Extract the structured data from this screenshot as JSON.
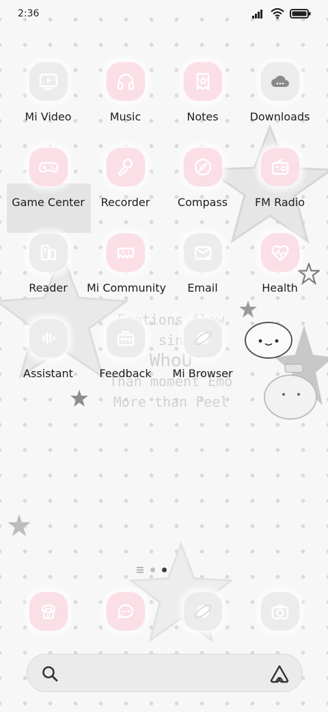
{
  "status": {
    "time": "2:36"
  },
  "wallpaper": {
    "lines": [
      "Emotions flow",
      "sin",
      "WhoU",
      "Than moment Emo",
      "More than Feel"
    ]
  },
  "apps": [
    {
      "label": "Mi Video",
      "icon": "tv-icon"
    },
    {
      "label": "Music",
      "icon": "headphones-icon"
    },
    {
      "label": "Notes",
      "icon": "notes-icon"
    },
    {
      "label": "Downloads",
      "icon": "cloud-download-icon"
    },
    {
      "label": "Game Center",
      "icon": "gamepad-icon"
    },
    {
      "label": "Recorder",
      "icon": "microphone-icon"
    },
    {
      "label": "Compass",
      "icon": "compass-icon"
    },
    {
      "label": "FM Radio",
      "icon": "radio-icon"
    },
    {
      "label": "Reader",
      "icon": "book-icon"
    },
    {
      "label": "Mi Community",
      "icon": "community-icon"
    },
    {
      "label": "Email",
      "icon": "mail-icon"
    },
    {
      "label": "Health",
      "icon": "heart-pulse-icon"
    },
    {
      "label": "Assistant",
      "icon": "voice-icon"
    },
    {
      "label": "Feedback",
      "icon": "toolbox-icon"
    },
    {
      "label": "Mi Browser",
      "icon": "planet-icon"
    }
  ],
  "dock": [
    {
      "name": "Phone",
      "icon": "phone-icon"
    },
    {
      "name": "Messages",
      "icon": "message-icon"
    },
    {
      "name": "Browser",
      "icon": "planet-icon"
    },
    {
      "name": "Camera",
      "icon": "camera-icon"
    }
  ],
  "pages": {
    "count": 2,
    "active": 2
  },
  "colors": {
    "pink_tile": "#fbdfe6",
    "grey_tile": "#ececec",
    "icon_stroke": "#ffffff"
  }
}
